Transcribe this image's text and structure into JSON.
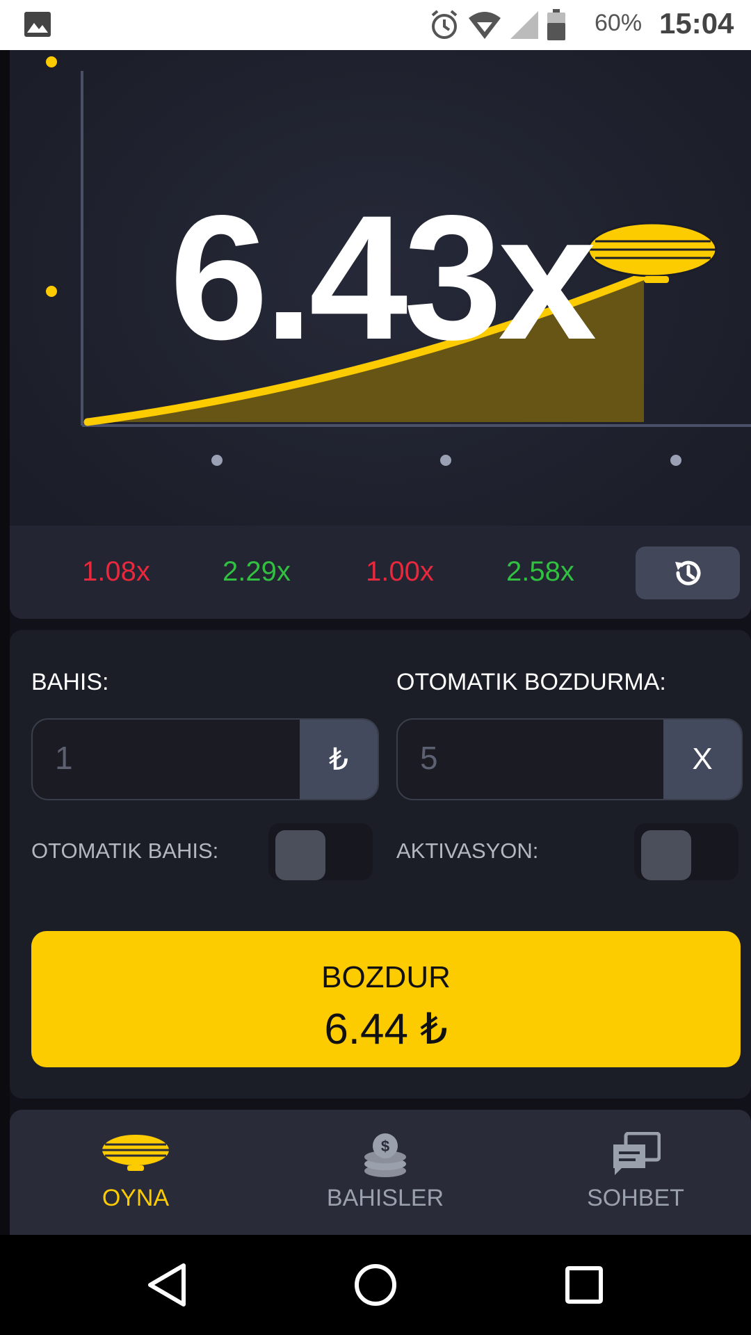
{
  "status_bar": {
    "battery": "60%",
    "time": "15:04"
  },
  "game": {
    "multiplier": "6.43x"
  },
  "history": [
    {
      "value": "1.08x",
      "color": "#e8283c"
    },
    {
      "value": "2.29x",
      "color": "#32c040"
    },
    {
      "value": "1.00x",
      "color": "#e8283c"
    },
    {
      "value": "2.58x",
      "color": "#32c040"
    }
  ],
  "bet": {
    "bet_label": "BAHIS:",
    "bet_value": "1",
    "bet_currency": "₺",
    "auto_cashout_label": "OTOMATIK BOZDURMA:",
    "auto_cashout_value": "5",
    "auto_cashout_suffix": "X",
    "auto_bet_label": "OTOMATIK BAHIS:",
    "activation_label": "AKTIVASYON:"
  },
  "cashout": {
    "label": "BOZDUR",
    "amount": "6.44 ₺"
  },
  "tabs": [
    {
      "label": "OYNA",
      "active": true
    },
    {
      "label": "BAHISLER",
      "active": false
    },
    {
      "label": "SOHBET",
      "active": false
    }
  ],
  "colors": {
    "accent": "#fccb00",
    "loss": "#e8283c",
    "win": "#32c040",
    "panel": "#1c1e27"
  }
}
